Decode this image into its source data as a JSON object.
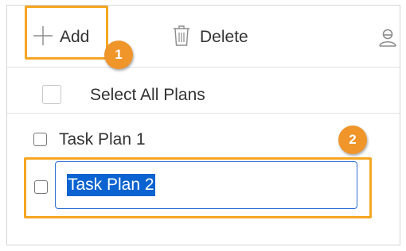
{
  "toolbar": {
    "add_label": "Add",
    "delete_label": "Delete",
    "icons": {
      "add": "plus-icon",
      "delete": "trash-icon",
      "user": "user-icon"
    }
  },
  "callouts": {
    "first": "1",
    "second": "2"
  },
  "select_all": {
    "label": "Select All Plans",
    "checked": false
  },
  "plans": [
    {
      "label": "Task Plan 1",
      "checked": false
    },
    {
      "value": "Task Plan 2",
      "checked": false,
      "editing": true,
      "text_selected": true
    }
  ],
  "colors": {
    "highlight": "#f5a623",
    "badge": "#f0952a",
    "input_border": "#2f6fd6",
    "selection": "#0a63d0"
  }
}
